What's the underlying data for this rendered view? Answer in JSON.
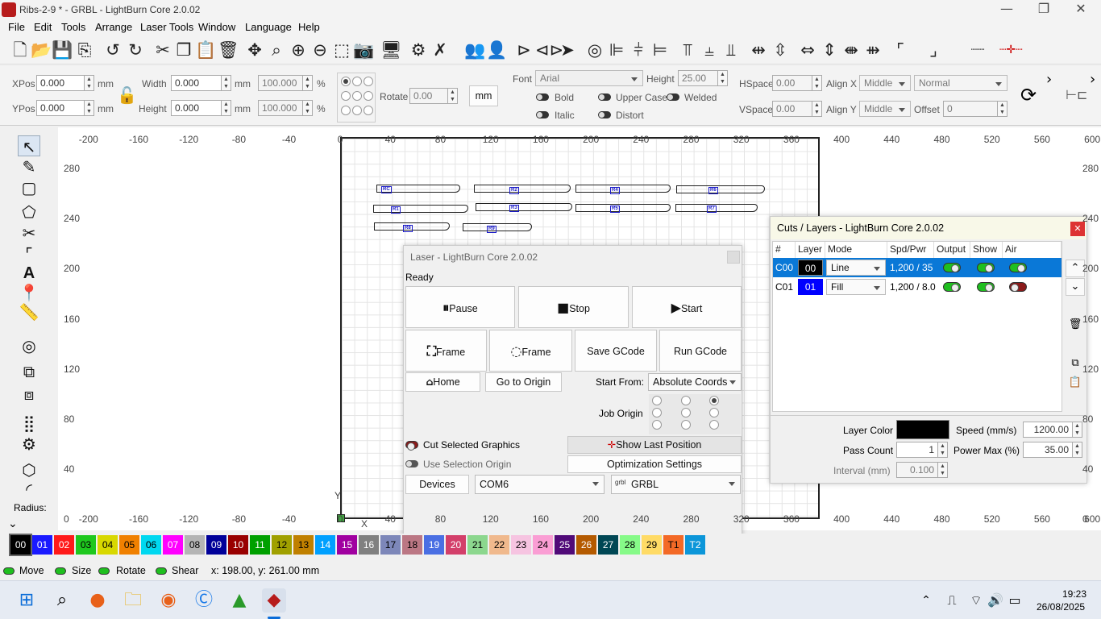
{
  "window": {
    "title": "Ribs-2-9 * - GRBL - LightBurn Core 2.0.02",
    "minimize": "—",
    "maximize": "❐",
    "close": "✕"
  },
  "menu": [
    "File",
    "Edit",
    "Tools",
    "Arrange",
    "Laser Tools",
    "Window",
    "Language",
    "Help"
  ],
  "toolbar_icons": [
    "new-file-icon",
    "open-folder-icon",
    "save-icon",
    "import-icon",
    "undo-icon",
    "redo-icon",
    "cut-icon",
    "copy-icon",
    "paste-icon",
    "delete-icon",
    "move-icon",
    "zoom-fit-icon",
    "zoom-in-icon",
    "zoom-out-icon",
    "select-frame-icon",
    "camera-icon",
    "monitor-icon",
    "settings-icon",
    "tools-icon",
    "group-icon",
    "user-icon",
    "mirror-icon",
    "flip-icon",
    "send-icon",
    "target-icon",
    "align-left-icon",
    "align-center-icon",
    "align-right-icon",
    "align-top-icon",
    "align-middle-icon",
    "align-bottom-icon",
    "distribute-h-icon",
    "distribute-v-icon",
    "space-h-icon",
    "space-v-icon",
    "space-both-icon",
    "corner-icon",
    "corner-alt-icon",
    "dots-line-icon",
    "crosshair-line-icon"
  ],
  "props": {
    "xpos_label": "XPos",
    "xpos": "0.000",
    "ypos_label": "YPos",
    "ypos": "0.000",
    "unit": "mm",
    "width_label": "Width",
    "width": "0.000",
    "height_label": "Height",
    "height": "0.000",
    "scale_x": "100.000",
    "scale_y": "100.000",
    "percent": "%",
    "rotate_label": "Rotate",
    "rotate": "0.00",
    "mm_button": "mm",
    "font_label": "Font",
    "font": "Arial",
    "fheight_label": "Height",
    "fheight": "25.00",
    "bold": "Bold",
    "italic": "Italic",
    "upper_case": "Upper Case",
    "distort": "Distort",
    "welded": "Welded",
    "hspace_label": "HSpace",
    "hspace": "0.00",
    "vspace_label": "VSpace",
    "vspace": "0.00",
    "alignx_label": "Align X",
    "alignx": "Middle",
    "aligny_label": "Align Y",
    "aligny": "Middle",
    "normal": "Normal",
    "offset_label": "Offset",
    "offset": "0"
  },
  "left_tools_radius": "Radius:",
  "ruler": {
    "x_top": [
      "-200",
      "-160",
      "-120",
      "-80",
      "-40",
      "0",
      "40",
      "80",
      "120",
      "160",
      "200",
      "240",
      "280",
      "320",
      "360",
      "400",
      "440",
      "480",
      "520",
      "560",
      "600"
    ],
    "y_left": [
      "280",
      "240",
      "200",
      "160",
      "120",
      "80",
      "40",
      "0"
    ],
    "y_right": [
      "280",
      "240",
      "200",
      "160",
      "120",
      "80",
      "40",
      "0"
    ],
    "x_axis_label": "X",
    "y_axis_label": "Y"
  },
  "ribs": [
    "RC",
    "R2",
    "R4",
    "R6",
    "R1",
    "R3",
    "R5",
    "R7",
    "R8",
    "R9"
  ],
  "laser": {
    "title": "Laser - LightBurn Core 2.0.02",
    "status": "Ready",
    "pause": "Pause",
    "stop": "Stop",
    "start": "Start",
    "frame1": "Frame",
    "frame2": "Frame",
    "save_gcode": "Save GCode",
    "run_gcode": "Run GCode",
    "home": "Home",
    "go_to_origin": "Go to Origin",
    "start_from_label": "Start From:",
    "start_from": "Absolute Coords",
    "job_origin": "Job Origin",
    "cut_selected": "Cut Selected Graphics",
    "use_selection_origin": "Use Selection Origin",
    "show_last_position": "Show Last Position",
    "optimization_settings": "Optimization Settings",
    "devices": "Devices",
    "port": "COM6",
    "device": "GRBL",
    "grbl_tag": "grbl"
  },
  "cuts": {
    "title": "Cuts / Layers - LightBurn Core 2.0.02",
    "headers": [
      "#",
      "Layer",
      "Mode",
      "Spd/Pwr",
      "Output",
      "Show",
      "Air"
    ],
    "rows": [
      {
        "num": "C00",
        "layer": "00",
        "mode": "Line",
        "spdpwr": "1,200 / 35",
        "layer_color": "#000000",
        "air": "on"
      },
      {
        "num": "C01",
        "layer": "01",
        "mode": "Fill",
        "spdpwr": "1,200 / 8.0",
        "layer_color": "#0000ff",
        "air": "off"
      }
    ],
    "layer_color_label": "Layer Color",
    "speed_label": "Speed (mm/s)",
    "speed": "1200.00",
    "pass_count_label": "Pass Count",
    "pass_count": "1",
    "power_max_label": "Power Max (%)",
    "power_max": "35.00",
    "interval_label": "Interval (mm)",
    "interval": "0.100"
  },
  "palette": [
    {
      "l": "00",
      "c": "#000000",
      "t": "#ffffff"
    },
    {
      "l": "01",
      "c": "#1a1aff",
      "t": "#ffffff"
    },
    {
      "l": "02",
      "c": "#ff1a1a",
      "t": "#ffffff"
    },
    {
      "l": "03",
      "c": "#1ec81e",
      "t": "#000000"
    },
    {
      "l": "04",
      "c": "#d8d800",
      "t": "#000000"
    },
    {
      "l": "05",
      "c": "#f08000",
      "t": "#000000"
    },
    {
      "l": "06",
      "c": "#00d8f0",
      "t": "#000000"
    },
    {
      "l": "07",
      "c": "#ff00ff",
      "t": "#ffffff"
    },
    {
      "l": "08",
      "c": "#b4b4b4",
      "t": "#000000"
    },
    {
      "l": "09",
      "c": "#000099",
      "t": "#ffffff"
    },
    {
      "l": "10",
      "c": "#990000",
      "t": "#ffffff"
    },
    {
      "l": "11",
      "c": "#00a000",
      "t": "#ffffff"
    },
    {
      "l": "12",
      "c": "#a0a000",
      "t": "#000000"
    },
    {
      "l": "13",
      "c": "#c08000",
      "t": "#000000"
    },
    {
      "l": "14",
      "c": "#00a0ff",
      "t": "#ffffff"
    },
    {
      "l": "15",
      "c": "#a000a0",
      "t": "#ffffff"
    },
    {
      "l": "16",
      "c": "#808080",
      "t": "#ffffff"
    },
    {
      "l": "17",
      "c": "#7d87b9",
      "t": "#000000"
    },
    {
      "l": "18",
      "c": "#bb7784",
      "t": "#000000"
    },
    {
      "l": "19",
      "c": "#4a6fe3",
      "t": "#ffffff"
    },
    {
      "l": "20",
      "c": "#d33f6a",
      "t": "#ffffff"
    },
    {
      "l": "21",
      "c": "#8cd78e",
      "t": "#000000"
    },
    {
      "l": "22",
      "c": "#f0b98d",
      "t": "#000000"
    },
    {
      "l": "23",
      "c": "#f6c4e1",
      "t": "#000000"
    },
    {
      "l": "24",
      "c": "#fa9ed4",
      "t": "#000000"
    },
    {
      "l": "25",
      "c": "#500a78",
      "t": "#ffffff"
    },
    {
      "l": "26",
      "c": "#b45a00",
      "t": "#ffffff"
    },
    {
      "l": "27",
      "c": "#004754",
      "t": "#ffffff"
    },
    {
      "l": "28",
      "c": "#86fa88",
      "t": "#000000"
    },
    {
      "l": "29",
      "c": "#ffdb66",
      "t": "#000000"
    },
    {
      "l": "T1",
      "c": "#f36926",
      "t": "#000000"
    },
    {
      "l": "T2",
      "c": "#0c96d9",
      "t": "#ffffff"
    }
  ],
  "status": {
    "move": "Move",
    "size": "Size",
    "rotate": "Rotate",
    "shear": "Shear",
    "coords": "x: 198.00, y: 261.00 mm"
  },
  "taskbar": {
    "time": "19:23",
    "date": "26/08/2025"
  }
}
